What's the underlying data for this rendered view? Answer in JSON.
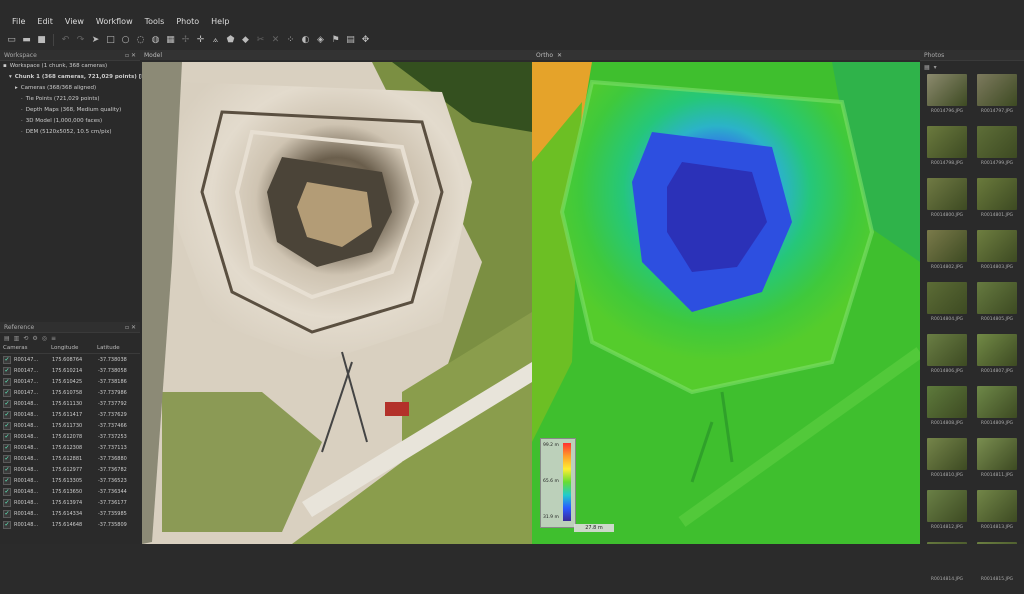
{
  "menu": [
    "File",
    "Edit",
    "View",
    "Workflow",
    "Tools",
    "Photo",
    "Help"
  ],
  "toolbar_icons": [
    "new-icon",
    "open-icon",
    "save-icon",
    "undo-icon",
    "redo-icon",
    "select-icon",
    "rect-select-icon",
    "circle-select-icon",
    "free-select-icon",
    "globe-icon",
    "grid-icon",
    "rotate-icon",
    "move-icon",
    "nav-icon",
    "polygon-icon",
    "shape-icon",
    "cut-icon",
    "crop-icon",
    "points-icon",
    "camera-icon",
    "shield-icon",
    "flag-icon",
    "layers-icon",
    "settings-icon"
  ],
  "workspace": {
    "title": "Workspace",
    "root": "Workspace (1 chunk, 368 cameras)",
    "chunk": "Chunk 1 (368 cameras, 721,029 points) [R]",
    "items": [
      "Cameras (368/368 aligned)",
      "Tie Points (721,029 points)",
      "Depth Maps (368, Medium quality)",
      "3D Model (1,000,000 faces)",
      "DEM (5120x5052, 10.5 cm/pix)"
    ]
  },
  "reference": {
    "title": "Reference",
    "columns": [
      "Cameras",
      "Longitude",
      "Latitude"
    ],
    "rows": [
      [
        "R00147...",
        "175.608764",
        "-37.738038"
      ],
      [
        "R00147...",
        "175.610214",
        "-37.738058"
      ],
      [
        "R00147...",
        "175.610425",
        "-37.738186"
      ],
      [
        "R00147...",
        "175.610758",
        "-37.737986"
      ],
      [
        "R00148...",
        "175.611130",
        "-37.737792"
      ],
      [
        "R00148...",
        "175.611417",
        "-37.737629"
      ],
      [
        "R00148...",
        "175.611730",
        "-37.737466"
      ],
      [
        "R00148...",
        "175.612078",
        "-37.737253"
      ],
      [
        "R00148...",
        "175.612308",
        "-37.737113"
      ],
      [
        "R00148...",
        "175.612881",
        "-37.736880"
      ],
      [
        "R00148...",
        "175.612977",
        "-37.736782"
      ],
      [
        "R00148...",
        "175.613305",
        "-37.736523"
      ],
      [
        "R00148...",
        "175.613650",
        "-37.736344"
      ],
      [
        "R00148...",
        "175.613974",
        "-37.736177"
      ],
      [
        "R00148...",
        "175.614334",
        "-37.735985"
      ],
      [
        "R00148...",
        "175.614648",
        "-37.735809"
      ]
    ]
  },
  "model_tab": "Model",
  "ortho_tab": "Ortho",
  "photos": {
    "title": "Photos",
    "items": [
      "R0014796.JPG",
      "R0014797.JPG",
      "R0014798.JPG",
      "R0014799.JPG",
      "R0014800.JPG",
      "R0014801.JPG",
      "R0014802.JPG",
      "R0014803.JPG",
      "R0014804.JPG",
      "R0014805.JPG",
      "R0014806.JPG",
      "R0014807.JPG",
      "R0014808.JPG",
      "R0014809.JPG",
      "R0014810.JPG",
      "R0014811.JPG",
      "R0014812.JPG",
      "R0014813.JPG",
      "R0014814.JPG",
      "R0014815.JPG"
    ]
  },
  "legend": {
    "max": "99.2 m",
    "mid": "65.6 m",
    "min": "31.9 m"
  },
  "scale": "27.8 m"
}
